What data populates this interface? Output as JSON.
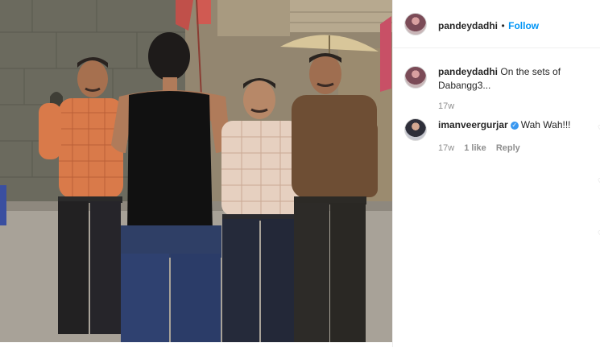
{
  "header": {
    "username": "pandeydadhi",
    "separator": "•",
    "follow_label": "Follow"
  },
  "caption": {
    "username": "pandeydadhi",
    "text": "On the sets of Dabangg3...",
    "time": "17w"
  },
  "comments": [
    {
      "username": "imanveergurjar",
      "verified": true,
      "text": "Wah Wah!!!",
      "time": "17w",
      "likes": "1 like",
      "reply_label": "Reply"
    }
  ],
  "icons": {
    "verified": "verified-badge-icon",
    "like": "heart-icon"
  },
  "colors": {
    "follow": "#0095f6",
    "meta": "#8e8e8e",
    "verified": "#3897f0"
  }
}
